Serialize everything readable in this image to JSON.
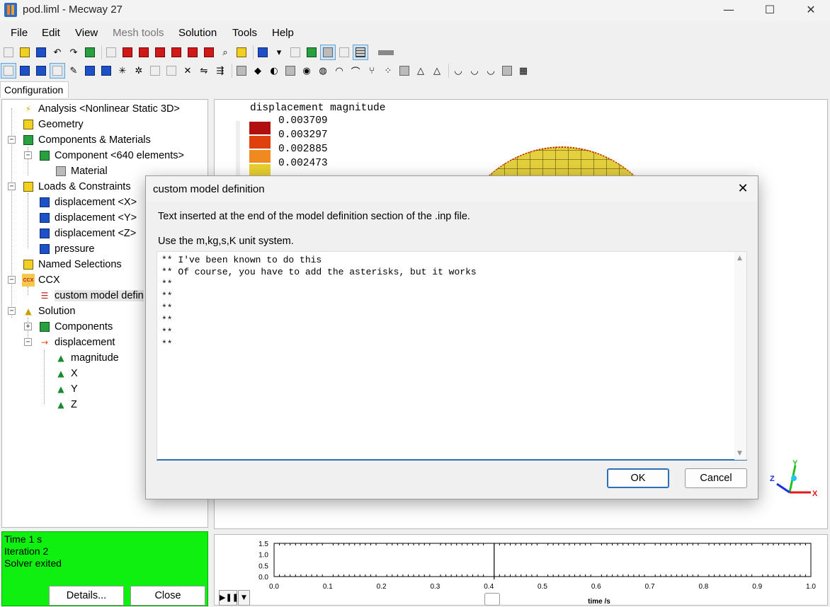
{
  "window": {
    "title": "pod.liml - Mecway 27",
    "min_glyph": "—",
    "max_glyph": "☐",
    "close_glyph": "✕"
  },
  "menu": {
    "file": "File",
    "edit": "Edit",
    "view": "View",
    "mesh_tools": "Mesh tools",
    "solution": "Solution",
    "tools": "Tools",
    "help": "Help"
  },
  "tabs": {
    "configuration": "Configuration"
  },
  "tree": {
    "analysis": "Analysis <Nonlinear Static 3D>",
    "geometry": "Geometry",
    "components_materials": "Components & Materials",
    "component": "Component <640 elements>",
    "material": "Material",
    "loads_constraints": "Loads & Constraints",
    "disp_x": "displacement <X>",
    "disp_y": "displacement <Y>",
    "disp_z": "displacement <Z>",
    "pressure": "pressure",
    "named_selections": "Named Selections",
    "ccx": "CCX",
    "custom_model_def": "custom model defin",
    "solution": "Solution",
    "sol_components": "Components",
    "sol_displacement": "displacement",
    "magnitude": "magnitude",
    "x": "X",
    "y": "Y",
    "z": "Z",
    "ccx_icon_text": "CCX"
  },
  "viewport": {
    "legend_title": "displacement magnitude",
    "legend_values": [
      "0.003709",
      "0.003297",
      "0.002885",
      "0.002473"
    ],
    "legend_colors": [
      "#b01010",
      "#e0400c",
      "#f08a20",
      "#e8d030"
    ],
    "axis_x": "X",
    "axis_y": "Y",
    "axis_z": "Z"
  },
  "status": {
    "line1": "Time 1 s",
    "line2": "Iteration 2",
    "line3": "Solver exited",
    "details_button": "Details...",
    "close_button": "Close",
    "color": "#10f010"
  },
  "timeline": {
    "y_ticks": [
      "1.5",
      "1.0",
      "0.5",
      "0.0"
    ],
    "x_ticks": [
      "0.0",
      "0.1",
      "0.2",
      "0.3",
      "0.4",
      "0.5",
      "0.6",
      "0.7",
      "0.8",
      "0.9",
      "1.0"
    ],
    "x_label": "time /s",
    "current_time": 0.41
  },
  "dialog": {
    "title": "custom model definition",
    "close_glyph": "✕",
    "description": "Text inserted at the end of the model definition section of the .inp file.",
    "units": "Use the m,kg,s,K unit system.",
    "editor_text": "** I've been known to do this\n** Of course, you have to add the asterisks, but it works\n**\n**\n**\n**\n**\n**",
    "ok_button": "OK",
    "cancel_button": "Cancel"
  }
}
